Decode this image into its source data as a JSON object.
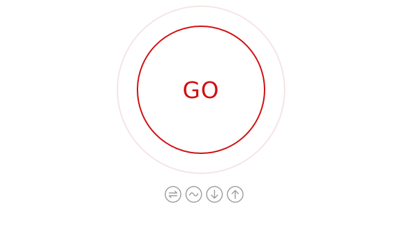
{
  "go_button": {
    "label": "GO",
    "color": "#d10f10",
    "halo_color": "#f6e4e4"
  },
  "icons": [
    "swap-arrows-icon",
    "wave-icon",
    "arrow-down-icon",
    "arrow-up-icon"
  ],
  "icon_color": "#9a9a9a"
}
